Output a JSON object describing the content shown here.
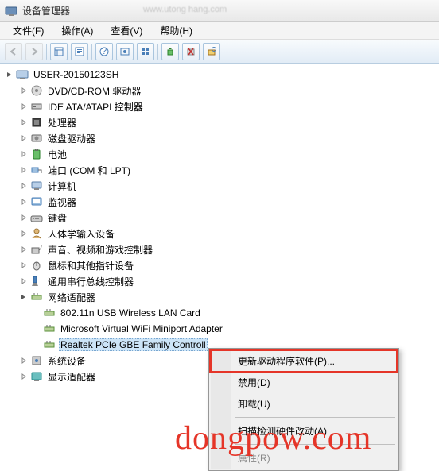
{
  "window": {
    "title": "设备管理器"
  },
  "url_hint": "www.utong hang.com",
  "menu": {
    "file": "文件(F)",
    "action": "操作(A)",
    "view": "查看(V)",
    "help": "帮助(H)"
  },
  "tree": {
    "root": "USER-20150123SH",
    "items": [
      "DVD/CD-ROM 驱动器",
      "IDE ATA/ATAPI 控制器",
      "处理器",
      "磁盘驱动器",
      "电池",
      "端口 (COM 和 LPT)",
      "计算机",
      "监视器",
      "键盘",
      "人体学输入设备",
      "声音、视频和游戏控制器",
      "鼠标和其他指针设备",
      "通用串行总线控制器",
      "网络适配器",
      "系统设备",
      "显示适配器"
    ],
    "net_children": [
      "802.11n USB Wireless LAN Card",
      "Microsoft Virtual WiFi Miniport Adapter",
      "Realtek PCIe GBE Family Controller"
    ],
    "selected": "Realtek PCIe GBE Family Controll"
  },
  "context": {
    "update": "更新驱动程序软件(P)...",
    "disable": "禁用(D)",
    "uninstall": "卸载(U)",
    "scan": "扫描检测硬件改动(A)",
    "prop": "属性(R)"
  },
  "watermark": "dongpow.com"
}
